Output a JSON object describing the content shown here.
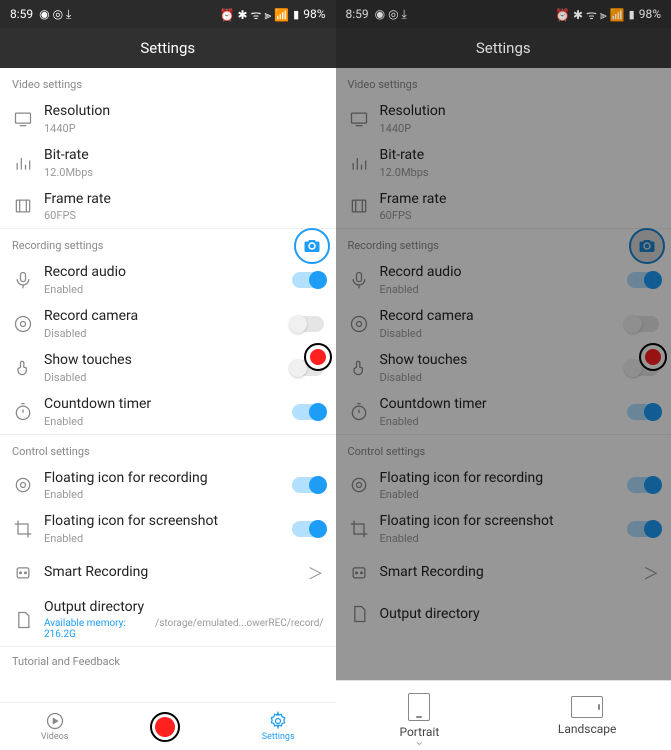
{
  "status": {
    "time": "8:59",
    "battery": "98%",
    "icons_left": "⬡ ⓘ ⌄",
    "icons_right": "⏰ ✻ ᯤ ⇅ ⫻ 📶"
  },
  "header": {
    "title": "Settings"
  },
  "sections": {
    "video": {
      "title": "Video settings",
      "resolution": {
        "label": "Resolution",
        "value": "1440P"
      },
      "bitrate": {
        "label": "Bit-rate",
        "value": "12.0Mbps"
      },
      "framerate": {
        "label": "Frame rate",
        "value": "60FPS"
      }
    },
    "recording": {
      "title": "Recording settings",
      "audio": {
        "label": "Record audio",
        "value": "Enabled"
      },
      "camera": {
        "label": "Record camera",
        "value": "Disabled"
      },
      "touches": {
        "label": "Show touches",
        "value": "Disabled"
      },
      "countdown": {
        "label": "Countdown timer",
        "value": "Enabled"
      }
    },
    "control": {
      "title": "Control settings",
      "float_rec": {
        "label": "Floating icon for recording",
        "value": "Enabled"
      },
      "float_shot": {
        "label": "Floating icon for screenshot",
        "value": "Enabled"
      },
      "smart": {
        "label": "Smart Recording"
      },
      "output": {
        "label": "Output directory",
        "memory": "Available memory: 216.2G",
        "path": "/storage/emulated...owerREC/record/"
      }
    },
    "tutorial": {
      "title": "Tutorial and Feedback"
    }
  },
  "bottom_nav": {
    "videos": "Videos",
    "settings": "Settings"
  },
  "orientation_sheet": {
    "portrait": "Portrait",
    "landscape": "Landscape"
  }
}
